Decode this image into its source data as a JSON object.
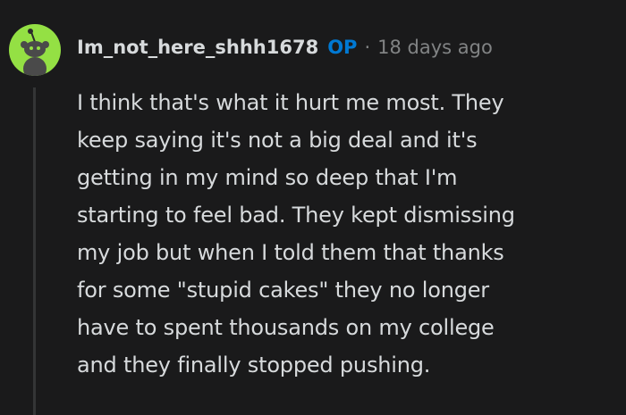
{
  "comment": {
    "username": "Im_not_here_shhh1678",
    "op_badge": "OP",
    "separator": "·",
    "timestamp": "18 days ago",
    "body_lines": [
      "I think that's what it hurt me most. They",
      "keep saying it's not a big deal and it's",
      "getting in my mind so deep that I'm",
      "starting to feel bad. They kept dismissing",
      "my job but when I told them that thanks",
      "for some \"stupid cakes\" they no longer",
      "have to spent thousands on my college",
      "and they finally stopped pushing."
    ]
  },
  "colors": {
    "background": "#1a1a1b",
    "text": "#d7dadc",
    "muted": "#818384",
    "op_badge": "#0079d3",
    "avatar_bg": "#94e044",
    "thread_line": "#343536"
  },
  "icons": {
    "avatar": "snoo-avatar-icon"
  }
}
